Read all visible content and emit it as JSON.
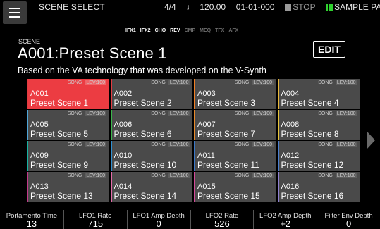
{
  "header": {
    "title": "SCENE SELECT",
    "time_signature": "4/4",
    "tempo": "♩=120.00",
    "position": "01-01-000",
    "stop_label": "STOP",
    "sample_pad_label": "SAMPLE PAD"
  },
  "effects": [
    {
      "label": "IFX1",
      "active": true
    },
    {
      "label": "IFX2",
      "active": true
    },
    {
      "label": "CHO",
      "active": true
    },
    {
      "label": "REV",
      "active": true
    },
    {
      "label": "CMP",
      "active": false
    },
    {
      "label": "MEQ",
      "active": false
    },
    {
      "label": "TFX",
      "active": false
    },
    {
      "label": "AFX",
      "active": false
    }
  ],
  "scene": {
    "small_label": "SCENE",
    "name": "A001:Preset Scene 1",
    "description": "Based on the VA technology that was developed on the V-Synth",
    "edit_label": "EDIT"
  },
  "grid": {
    "cells": [
      {
        "num": "A001",
        "name": "Preset Scene 1",
        "song": "SONG",
        "lev": "LEV:100",
        "color": "#e53b41",
        "selected": true
      },
      {
        "num": "A002",
        "name": "Preset Scene 2",
        "song": "SONG",
        "lev": "LEV:100",
        "color": "#e53b41",
        "selected": false
      },
      {
        "num": "A003",
        "name": "Preset Scene 3",
        "song": "SONG",
        "lev": "LEV:100",
        "color": "#ef7f24",
        "selected": false
      },
      {
        "num": "A004",
        "name": "Preset Scene 4",
        "song": "SONG",
        "lev": "LEV:100",
        "color": "#e9b83a",
        "selected": false
      },
      {
        "num": "A005",
        "name": "Preset Scene 5",
        "song": "SONG",
        "lev": "LEV:100",
        "color": "#4fa6d8",
        "selected": false
      },
      {
        "num": "A006",
        "name": "Preset Scene 6",
        "song": "SONG",
        "lev": "LEV:100",
        "color": "#3bb54a",
        "selected": false
      },
      {
        "num": "A007",
        "name": "Preset Scene 7",
        "song": "SONG",
        "lev": "LEV:100",
        "color": "#e88a2a",
        "selected": false
      },
      {
        "num": "A008",
        "name": "Preset Scene 8",
        "song": "SONG",
        "lev": "LEV:100",
        "color": "#e8c43a",
        "selected": false
      },
      {
        "num": "A009",
        "name": "Preset Scene 9",
        "song": "SONG",
        "lev": "LEV:100",
        "color": "#17b3a3",
        "selected": false
      },
      {
        "num": "A010",
        "name": "Preset Scene 10",
        "song": "SONG",
        "lev": "LEV:100",
        "color": "#2f8fd0",
        "selected": false
      },
      {
        "num": "A011",
        "name": "Preset Scene 11",
        "song": "SONG",
        "lev": "LEV:100",
        "color": "#3a78c8",
        "selected": false
      },
      {
        "num": "A012",
        "name": "Preset Scene 12",
        "song": "SONG",
        "lev": "LEV:100",
        "color": "#4a7fd0",
        "selected": false
      },
      {
        "num": "A013",
        "name": "Preset Scene 13",
        "song": "SONG",
        "lev": "LEV:100",
        "color": "#c23a8a",
        "selected": false
      },
      {
        "num": "A014",
        "name": "Preset Scene 14",
        "song": "SONG",
        "lev": "LEV:100",
        "color": "#e36aa7",
        "selected": false
      },
      {
        "num": "A015",
        "name": "Preset Scene 15",
        "song": "SONG",
        "lev": "LEV:100",
        "color": "#d44a9a",
        "selected": false
      },
      {
        "num": "A016",
        "name": "Preset Scene 16",
        "song": "SONG",
        "lev": "LEV:100",
        "color": "#8e7fd0",
        "selected": false
      }
    ]
  },
  "params": [
    {
      "label": "Portamento Time",
      "value": "13"
    },
    {
      "label": "LFO1 Rate",
      "value": "715"
    },
    {
      "label": "LFO1 Amp Depth",
      "value": "0"
    },
    {
      "label": "LFO2 Rate",
      "value": "526"
    },
    {
      "label": "LFO2 Amp Depth",
      "value": "+2"
    },
    {
      "label": "Filter Env Depth",
      "value": "0"
    }
  ]
}
